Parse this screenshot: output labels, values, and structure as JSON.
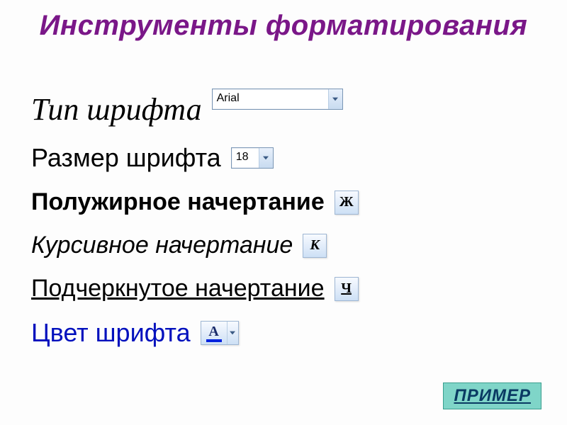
{
  "title": "Инструменты форматирования",
  "rows": {
    "font_type": {
      "label": "Тип шрифта",
      "value": "Arial"
    },
    "font_size": {
      "label": "Размер шрифта",
      "value": "18"
    },
    "bold": {
      "label": "Полужирное начертание",
      "button": "Ж"
    },
    "italic": {
      "label": "Курсивное начертание",
      "button": "К"
    },
    "underline": {
      "label": "Подчеркнутое начертание",
      "button": "Ч"
    },
    "color": {
      "label": "Цвет шрифта",
      "glyph": "А",
      "bar_color": "#0022dd"
    }
  },
  "example_button": "ПРИМЕР"
}
